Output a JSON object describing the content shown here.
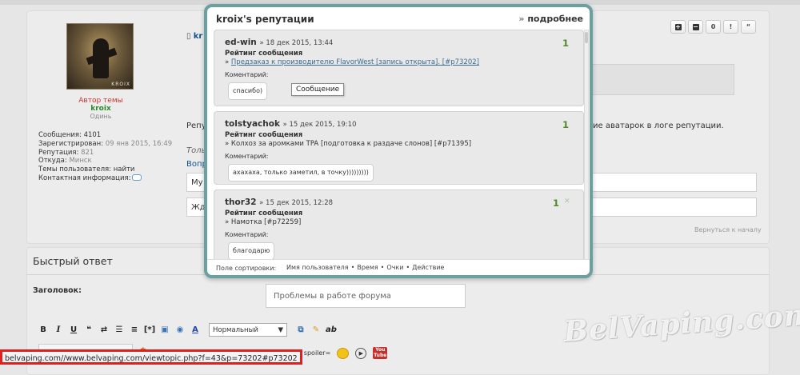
{
  "post": {
    "author_role": "Автор темы",
    "author_name": "kroix",
    "author_rank": "Одинь",
    "avatar_tag": "KROIX",
    "profile": {
      "posts_label": "Сообщения:",
      "posts_value": "4101",
      "registered_label": "Зарегистрирован:",
      "registered_value": "09 янв 2015, 16:49",
      "reputation_label": "Репутация:",
      "reputation_value": "821",
      "location_label": "Откуда:",
      "location_value": "Минск",
      "user_topics_label": "Темы пользователя:",
      "user_topics_value": "найти",
      "contact_label": "Контактная информация:"
    },
    "title_fragment": "kr",
    "buttons": {
      "plus": "+",
      "minus": "−",
      "count": "0",
      "report": "!",
      "quote": "“"
    },
    "body_fragment_left": "Репу",
    "body_fragment_right": "ие аватарок в логе репутации.",
    "italic_fragment": "Толь",
    "link_fragment": "Вопр",
    "field1_fragment": "Му",
    "field2_fragment": "Жд",
    "back_to_top": "Вернуться к началу"
  },
  "quick_reply": {
    "title": "Быстрый ответ",
    "subject_label": "Заголовок:",
    "subject_value": "Проблемы в работе форума",
    "toolbar": {
      "bold": "B",
      "italic": "I",
      "underline": "U",
      "font_size_selected": "Нормальный",
      "spoiler": "spoiler",
      "spoiler_eq": "spoiler=",
      "ab": "ab",
      "youtube": "You Tube"
    }
  },
  "status_bar": {
    "url": "belvaping.com//www.belvaping.com/viewtopic.php?f=43&p=73202#p73202"
  },
  "watermark": "BelVaping.com",
  "reputation_popup": {
    "title": "kroix's репутации",
    "more_arrow": "»",
    "more_label": "подробнее",
    "tooltip": "Сообщение",
    "entries": [
      {
        "user": "ed-win",
        "date": "» 18 дек 2015, 13:44",
        "score": "1",
        "heading": "Рейтинг сообщения",
        "link_prefix": "» ",
        "link_text": "Предзаказ к производителю FlavorWest [запись открыта]. [#p73202]",
        "comment_label": "Коментарий:",
        "comment": "спасибо)"
      },
      {
        "user": "tolstyachok",
        "date": "» 15 дек 2015, 19:10",
        "score": "1",
        "heading": "Рейтинг сообщения",
        "link_prefix": "» ",
        "link_text": "Колхоз за аромками TPA [подготовка к раздаче слонов] [#p71395]",
        "comment_label": "Коментарий:",
        "comment": "ахахаха, только заметил, в точку)))))))))"
      },
      {
        "user": "thor32",
        "date": "» 15 дек 2015, 12:28",
        "score": "1",
        "heading": "Рейтинг сообщения",
        "link_prefix": "» ",
        "link_text": "Намотка [#p72259]",
        "comment_label": "Коментарий:",
        "comment": "благодарю"
      }
    ],
    "footer": {
      "sort_label": "Поле сортировки:",
      "options": [
        "Имя пользователя",
        "Время",
        "Очки",
        "Действие"
      ],
      "separator": "•"
    }
  },
  "colors": {
    "popup_border": "#6aa0a0",
    "score_green": "#4d8a2a",
    "author_role_red": "#d2322d",
    "author_name_green": "#2a8a2a",
    "status_highlight": "#e02020"
  }
}
